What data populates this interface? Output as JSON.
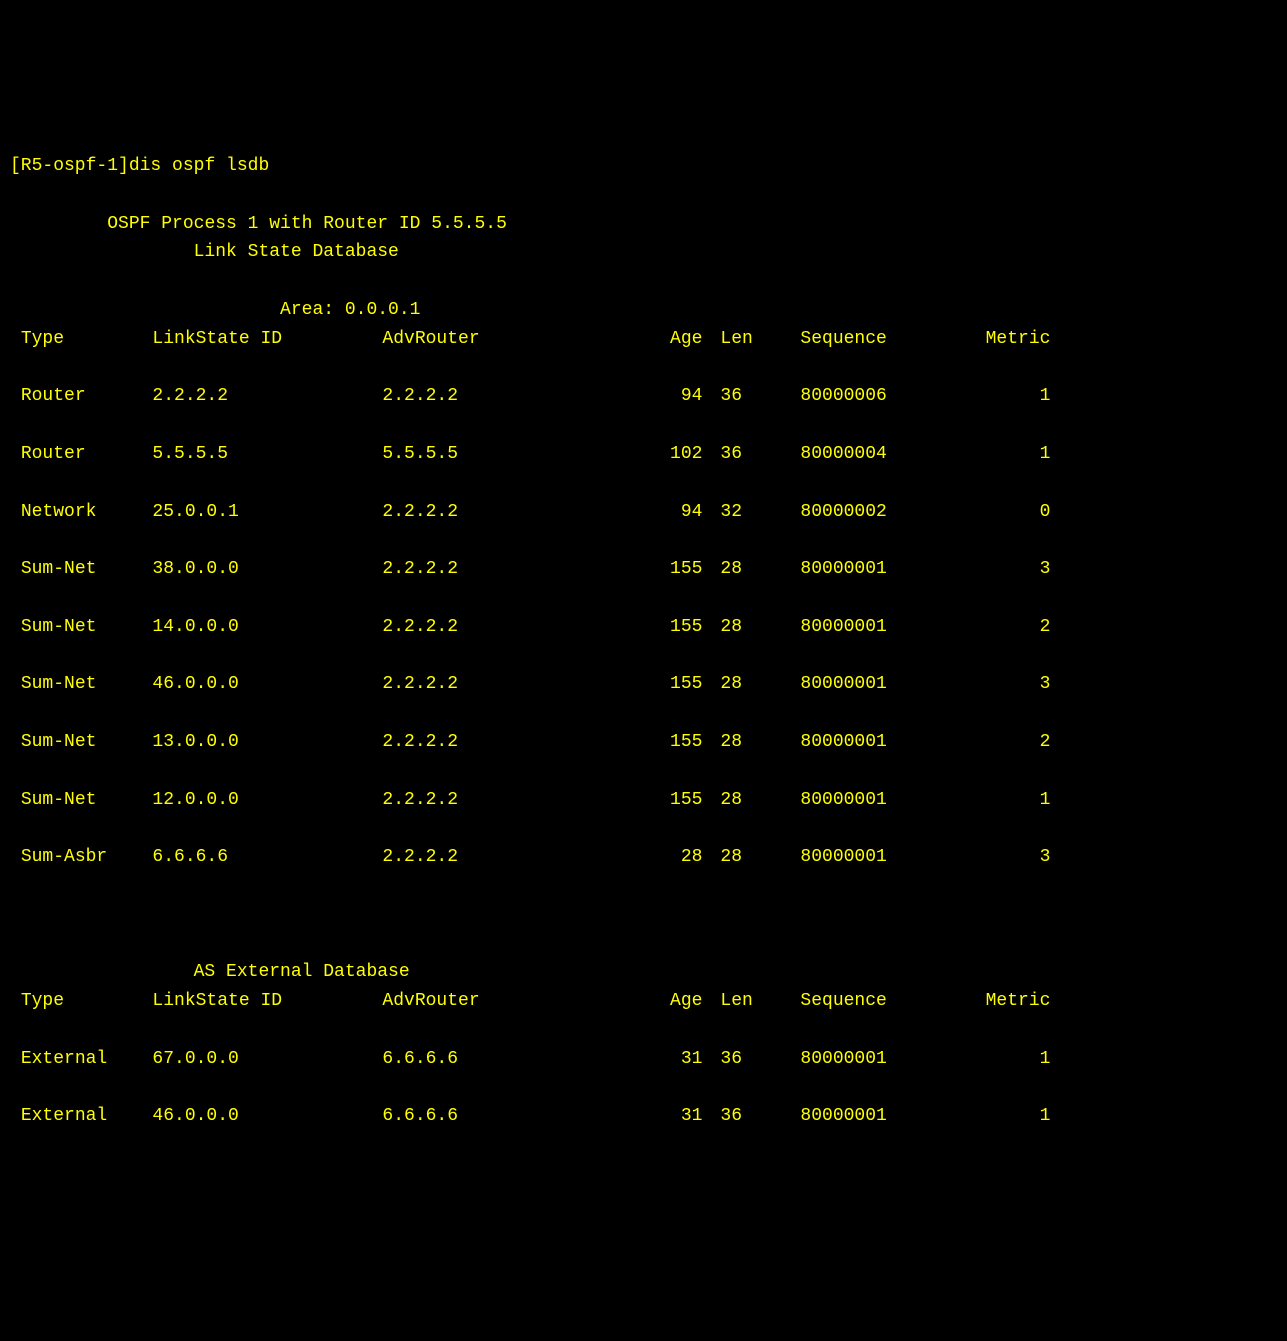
{
  "prompt": "[R5-ospf-1]",
  "command": "dis ospf lsdb",
  "header1": "\t OSPF Process 1 with Router ID 5.5.5.5",
  "header2": "\t\t Link State Database",
  "area_label": "\t\t         Area: 0.0.0.1",
  "columns": {
    "type": "Type",
    "lsid": "LinkState ID",
    "adv": "AdvRouter",
    "age": "Age",
    "len": "Len",
    "seq": "Sequence",
    "metric": "Metric"
  },
  "area_rows": [
    {
      "type": "Router",
      "lsid": "2.2.2.2",
      "adv": "2.2.2.2",
      "age": "94",
      "len": "36",
      "seq": "80000006",
      "metric": "1"
    },
    {
      "type": "Router",
      "lsid": "5.5.5.5",
      "adv": "5.5.5.5",
      "age": "102",
      "len": "36",
      "seq": "80000004",
      "metric": "1"
    },
    {
      "type": "Network",
      "lsid": "25.0.0.1",
      "adv": "2.2.2.2",
      "age": "94",
      "len": "32",
      "seq": "80000002",
      "metric": "0"
    },
    {
      "type": "Sum-Net",
      "lsid": "38.0.0.0",
      "adv": "2.2.2.2",
      "age": "155",
      "len": "28",
      "seq": "80000001",
      "metric": "3"
    },
    {
      "type": "Sum-Net",
      "lsid": "14.0.0.0",
      "adv": "2.2.2.2",
      "age": "155",
      "len": "28",
      "seq": "80000001",
      "metric": "2"
    },
    {
      "type": "Sum-Net",
      "lsid": "46.0.0.0",
      "adv": "2.2.2.2",
      "age": "155",
      "len": "28",
      "seq": "80000001",
      "metric": "3"
    },
    {
      "type": "Sum-Net",
      "lsid": "13.0.0.0",
      "adv": "2.2.2.2",
      "age": "155",
      "len": "28",
      "seq": "80000001",
      "metric": "2"
    },
    {
      "type": "Sum-Net",
      "lsid": "12.0.0.0",
      "adv": "2.2.2.2",
      "age": "155",
      "len": "28",
      "seq": "80000001",
      "metric": "1"
    },
    {
      "type": "Sum-Asbr",
      "lsid": "6.6.6.6",
      "adv": "2.2.2.2",
      "age": "28",
      "len": "28",
      "seq": "80000001",
      "metric": "3"
    }
  ],
  "ext_header": "\t\t AS External Database",
  "ext_rows": [
    {
      "type": "External",
      "lsid": "67.0.0.0",
      "adv": "6.6.6.6",
      "age": "31",
      "len": "36",
      "seq": "80000001",
      "metric": "1"
    },
    {
      "type": "External",
      "lsid": "46.0.0.0",
      "adv": "6.6.6.6",
      "age": "31",
      "len": "36",
      "seq": "80000001",
      "metric": "1"
    }
  ]
}
